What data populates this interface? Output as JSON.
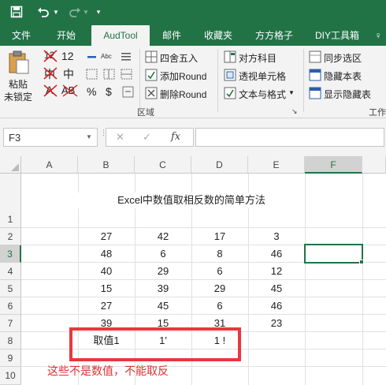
{
  "quick_access": {
    "save_icon": "save-icon",
    "undo_icon": "undo-icon",
    "redo_icon": "redo-icon",
    "customize_icon": "customize-icon"
  },
  "tabs": [
    "文件",
    "开始",
    "AudTool",
    "邮件",
    "收藏夹",
    "方方格子",
    "DIY工具箱",
    "♀"
  ],
  "active_tab": "AudTool",
  "ribbon": {
    "paste_label_1": "粘贴",
    "paste_label_2": "未锁定",
    "num_12": "12",
    "zh_1": "中",
    "zh_2": "中",
    "ab_1": "A",
    "ab_2": "AB",
    "percent": "%",
    "dollar": "$",
    "round_label": "四舍五入",
    "add_round_label": "添加Round",
    "del_round_label": "删除Round",
    "compare_label": "对方科目",
    "transparent_cell_label": "透视单元格",
    "text_format_label": "文本与格式",
    "sync_label": "同步选区",
    "hide_sheet_label": "隐藏本表",
    "show_hidden_label": "显示隐藏表",
    "work_label": "工作",
    "area_group_label": "区域"
  },
  "formula_bar": {
    "name_box": "F3",
    "cancel": "✕",
    "enter": "✓",
    "fx": "fx",
    "formula": ""
  },
  "columns": [
    "A",
    "B",
    "C",
    "D",
    "E",
    "F"
  ],
  "selected_column": "F",
  "rows": [
    "1",
    "2",
    "3",
    "4",
    "5",
    "6",
    "7",
    "8",
    "9",
    "10"
  ],
  "selected_row": "3",
  "sheet_title": "Excel中数值取相反数的简单方法",
  "table": [
    [
      "27",
      "42",
      "17",
      "3"
    ],
    [
      "48",
      "6",
      "8",
      "46"
    ],
    [
      "40",
      "29",
      "6",
      "12"
    ],
    [
      "15",
      "39",
      "29",
      "45"
    ],
    [
      "27",
      "45",
      "6",
      "46"
    ],
    [
      "39",
      "15",
      "31",
      "23"
    ]
  ],
  "row8": [
    "取值1",
    "1'",
    "1 !"
  ],
  "annotation": "这些不是数值，不能取反",
  "colors": {
    "excel_green": "#217346",
    "red_box": "#e8383d",
    "annotation_red": "#e03030"
  }
}
